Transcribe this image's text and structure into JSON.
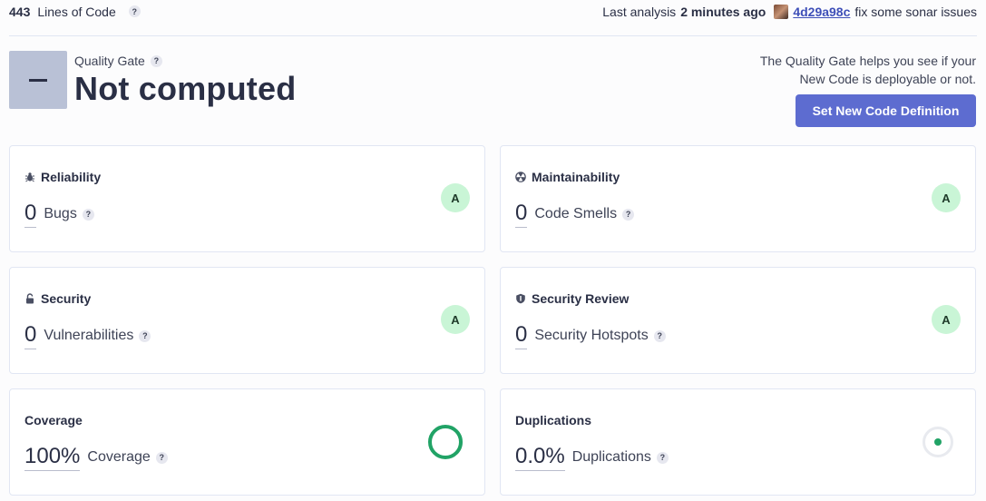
{
  "header": {
    "loc_value": "443",
    "loc_label": "Lines of Code",
    "help": "?",
    "last_analysis_label": "Last analysis",
    "last_analysis_time": "2 minutes ago",
    "commit_hash": "4d29a98c",
    "commit_message": "fix some sonar issues"
  },
  "quality_gate": {
    "label": "Quality Gate",
    "status": "Not computed",
    "info_line1": "The Quality Gate helps you see if your",
    "info_line2": "New Code is deployable or not.",
    "cta_label": "Set New Code Definition"
  },
  "cards": {
    "reliability": {
      "title": "Reliability",
      "value": "0",
      "metric": "Bugs",
      "rating": "A"
    },
    "maintainability": {
      "title": "Maintainability",
      "value": "0",
      "metric": "Code Smells",
      "rating": "A"
    },
    "security": {
      "title": "Security",
      "value": "0",
      "metric": "Vulnerabilities",
      "rating": "A"
    },
    "security_review": {
      "title": "Security Review",
      "value": "0",
      "metric": "Security Hotspots",
      "rating": "A"
    },
    "coverage": {
      "title": "Coverage",
      "value": "100%",
      "metric": "Coverage",
      "fraction": 1.0
    },
    "duplications": {
      "title": "Duplications",
      "value": "0.0%",
      "metric": "Duplications",
      "fraction": 0.0
    }
  },
  "colors": {
    "accent": "#5d6cd0",
    "rating_a": "#c9f5d6",
    "coverage_green": "#21a366",
    "qg_badge": "#b9c1d6"
  },
  "icons": {
    "reliability": "bug-icon",
    "maintainability": "radiation-icon",
    "security": "lock-icon",
    "security_review": "shield-icon"
  }
}
